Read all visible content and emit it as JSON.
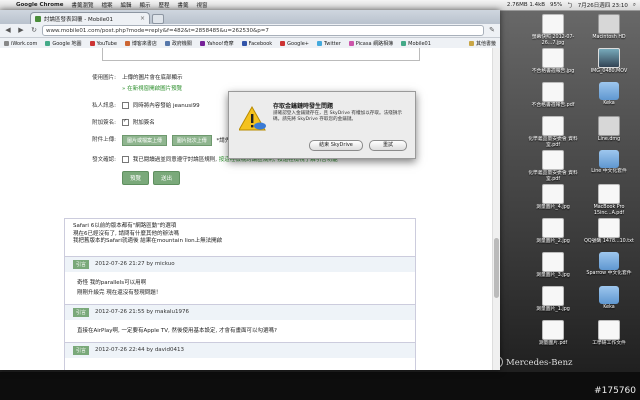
{
  "menubar": {
    "app_name": "Google Chrome",
    "items": [
      "書籤瀏覽",
      "檔案",
      "編輯",
      "顯示",
      "歷程",
      "書籤",
      "視窗",
      "說明"
    ],
    "status_items": [
      "2.76MB 1.4kB",
      "95%",
      "ㄅ",
      "7月26日週四 23:10"
    ],
    "spotlight": "⌕"
  },
  "browser": {
    "tab_title": "討論區發表回覆 - Mobile01",
    "url": "www.mobile01.com/post.php?mode=reply&f=482&t=2858485&u=262530&p=7",
    "bookmarks": [
      {
        "label": "iWork.com",
        "color": "#888"
      },
      {
        "label": "Google 地圖",
        "color": "#4a8"
      },
      {
        "label": "YouTube",
        "color": "#c33"
      },
      {
        "label": "博客來書店",
        "color": "#c63"
      },
      {
        "label": "政府機關",
        "color": "#57a"
      },
      {
        "label": "Yahoo!奇摩",
        "color": "#729"
      },
      {
        "label": "Facebook",
        "color": "#35a"
      },
      {
        "label": "Google+",
        "color": "#c33"
      },
      {
        "label": "Twitter",
        "color": "#4ad"
      },
      {
        "label": "Picasa 網路相簿",
        "color": "#c5a"
      },
      {
        "label": "Mobile01",
        "color": "#4a8"
      }
    ],
    "other_bookmarks": "其他書籤"
  },
  "form": {
    "use_image_label": "使用圖片:",
    "use_image_text": "上傳的圖片會在底部顯示",
    "use_image_link": "» 在新視窗開啟圖片預覽",
    "private_label": "私人訊息:",
    "private_text": "同時將內容發給 jeanusi99",
    "signature_label": "附加簽名:",
    "signature_text": "附加簽名",
    "upload_label": "附件上傳:",
    "upload_btn1": "圖片或檔案上傳",
    "upload_btn2": "圖片批次上傳",
    "upload_note": "*請先",
    "confirm_label": "發文確認:",
    "confirm_text": "我已閱讀過並同意遵守討論區規則,",
    "confirm_link": "按這裡檢視討論區規則, 按這裡檢視了解引言功能",
    "preview_btn": "預覽",
    "submit_btn": "送出"
  },
  "posts": {
    "first_body": [
      "Safari 6以前的版本都有\"網路區動\"的選項",
      "現在6已經沒有了, 請問有什麼其他的辦法嗎",
      "我把舊版本的Safari就適後 結果在mountain lion上無法開啟"
    ],
    "entries": [
      {
        "quote": "引言",
        "meta": "2012-07-26 21:27 by mickuo",
        "lines": [
          "奇怪 我的parallels可以用啊",
          "剛剛升級完 現在還沒有發現問題！"
        ]
      },
      {
        "quote": "引言",
        "meta": "2012-07-26 21:55 by makalu1976",
        "lines": [
          "直接在AirPlay啊, 一定要有Apple TV, 然後使用基本設定, 才會有畫面可以勾選嗎?"
        ]
      },
      {
        "quote": "引言",
        "meta": "2012-07-26 22:44 by david0413",
        "lines": []
      }
    ]
  },
  "dialog": {
    "title": "存取金鑰鏈時發生問題",
    "message": "請確認登入金鑰鏈存在，且 SkyDrive 有權加以存取。法殘損示碼，請先將 SkyDrive 存取您的金鑰鏈。",
    "button_quit": "結束 SkyDrive",
    "button_retry": "重試"
  },
  "desktop": {
    "icons": [
      {
        "label": "螢幕快照 2012-07-26...7.jpg",
        "kind": "doc"
      },
      {
        "label": "Macintosh HD",
        "kind": "disk"
      },
      {
        "label": "不合格書週報告.jpg",
        "kind": "doc"
      },
      {
        "label": "IMG_0480.MOV",
        "kind": "img"
      },
      {
        "label": "不合格書週報告.pdf",
        "kind": "doc"
      },
      {
        "label": "Keka",
        "kind": "folder"
      },
      {
        "label": "化學義品量安委會 資料室.pdf",
        "kind": "doc"
      },
      {
        "label": "Line.dmg",
        "kind": "disk"
      },
      {
        "label": "化學義品量安委會 資料室.pdf",
        "kind": "doc"
      },
      {
        "label": "Line 中文化套件",
        "kind": "folder"
      },
      {
        "label": "測量圖片_4.jpg",
        "kind": "doc"
      },
      {
        "label": "MacBook Pro 15inc...A.pdf",
        "kind": "doc"
      },
      {
        "label": "測量圖片_2.jpg",
        "kind": "doc"
      },
      {
        "label": "QQ號碼 1478...10.txt",
        "kind": "doc"
      },
      {
        "label": "測量圖片_3.jpg",
        "kind": "doc"
      },
      {
        "label": "Sparrow 中文化套件",
        "kind": "folder"
      },
      {
        "label": "測量圖片_1.jpg",
        "kind": "doc"
      },
      {
        "label": "Keka",
        "kind": "folder"
      },
      {
        "label": "測量圖片.pdf",
        "kind": "doc"
      },
      {
        "label": "工學研工作文件",
        "kind": "doc"
      }
    ],
    "brand": "Mercedes-Benz"
  },
  "watermark": "#175760"
}
